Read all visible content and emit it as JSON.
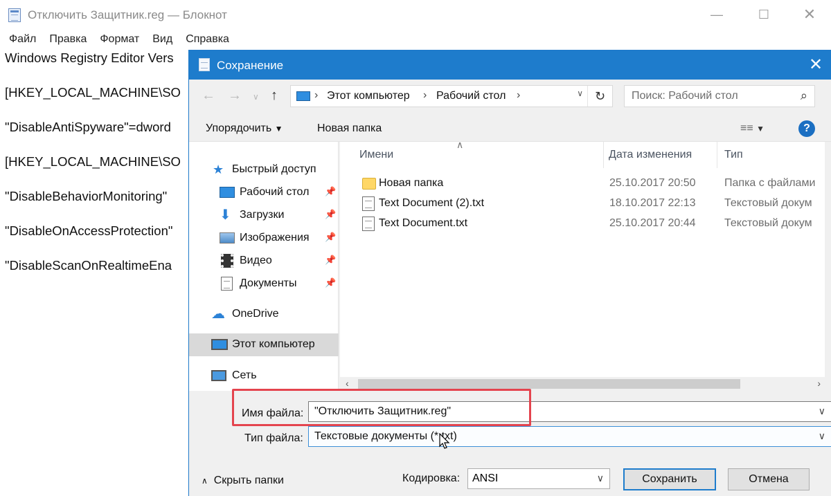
{
  "notepad": {
    "title": "Отключить Защитник.reg — Блокнот",
    "menu": [
      "Файл",
      "Правка",
      "Формат",
      "Вид",
      "Справка"
    ],
    "lines": [
      "Windows Registry Editor Vers",
      "[HKEY_LOCAL_MACHINE\\SO",
      "\"DisableAntiSpyware\"=dword",
      "[HKEY_LOCAL_MACHINE\\SO",
      "\"DisableBehaviorMonitoring\"",
      "\"DisableOnAccessProtection\"",
      "\"DisableScanOnRealtimeEna"
    ]
  },
  "dialog": {
    "title": "Сохранение",
    "address": {
      "crumbs": [
        "Этот компьютер",
        "Рабочий стол"
      ]
    },
    "search_placeholder": "Поиск: Рабочий стол",
    "toolbar": {
      "organize": "Упорядочить",
      "new_folder": "Новая папка"
    },
    "nav": [
      {
        "label": "Быстрый доступ",
        "icon": "star-icon"
      },
      {
        "label": "Рабочий стол",
        "icon": "desktop-icon",
        "pinned": true
      },
      {
        "label": "Загрузки",
        "icon": "download-icon",
        "pinned": true
      },
      {
        "label": "Изображения",
        "icon": "pictures-icon",
        "pinned": true
      },
      {
        "label": "Видео",
        "icon": "video-icon",
        "pinned": true
      },
      {
        "label": "Документы",
        "icon": "documents-icon",
        "pinned": true
      },
      {
        "label": "OneDrive",
        "icon": "cloud-icon"
      },
      {
        "label": "Этот компьютер",
        "icon": "computer-icon",
        "selected": true
      },
      {
        "label": "Сеть",
        "icon": "network-icon"
      }
    ],
    "columns": {
      "name": "Имени",
      "date": "Дата изменения",
      "type": "Тип"
    },
    "files": [
      {
        "name": "Новая папка",
        "date": "25.10.2017 20:50",
        "type": "Папка с файлами",
        "kind": "folder"
      },
      {
        "name": "Text Document (2).txt",
        "date": "18.10.2017 22:13",
        "type": "Текстовый докум",
        "kind": "doc"
      },
      {
        "name": "Text Document.txt",
        "date": "25.10.2017 20:44",
        "type": "Текстовый докум",
        "kind": "doc"
      }
    ],
    "filename_label": "Имя файла:",
    "filename_value": "\"Отключить Защитник.reg\"",
    "filetype_label": "Тип файла:",
    "filetype_value": "Текстовые документы (*.txt)",
    "hide_folders": "Скрыть папки",
    "encoding_label": "Кодировка:",
    "encoding_value": "ANSI",
    "save": "Сохранить",
    "cancel": "Отмена"
  },
  "colors": {
    "title_bar": "#1e7ccc",
    "highlight": "#e4444e",
    "selected_nav": "#d9d9d9"
  }
}
